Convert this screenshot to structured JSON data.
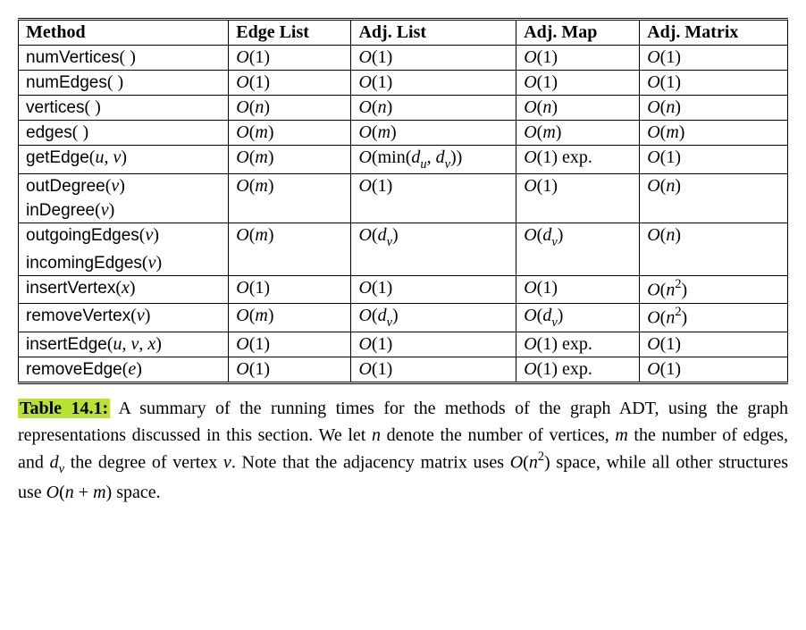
{
  "chart_data": {
    "type": "table",
    "title": "Table 14.1",
    "columns": [
      "Method",
      "Edge List",
      "Adj. List",
      "Adj. Map",
      "Adj. Matrix"
    ],
    "rows": [
      {
        "method": "numVertices()",
        "edge_list": "O(1)",
        "adj_list": "O(1)",
        "adj_map": "O(1)",
        "adj_matrix": "O(1)"
      },
      {
        "method": "numEdges()",
        "edge_list": "O(1)",
        "adj_list": "O(1)",
        "adj_map": "O(1)",
        "adj_matrix": "O(1)"
      },
      {
        "method": "vertices()",
        "edge_list": "O(n)",
        "adj_list": "O(n)",
        "adj_map": "O(n)",
        "adj_matrix": "O(n)"
      },
      {
        "method": "edges()",
        "edge_list": "O(m)",
        "adj_list": "O(m)",
        "adj_map": "O(m)",
        "adj_matrix": "O(m)"
      },
      {
        "method": "getEdge(u, v)",
        "edge_list": "O(m)",
        "adj_list": "O(min(d_u, d_v))",
        "adj_map": "O(1) exp.",
        "adj_matrix": "O(1)"
      },
      {
        "method": "outDegree(v) / inDegree(v)",
        "edge_list": "O(m)",
        "adj_list": "O(1)",
        "adj_map": "O(1)",
        "adj_matrix": "O(n)"
      },
      {
        "method": "outgoingEdges(v) / incomingEdges(v)",
        "edge_list": "O(m)",
        "adj_list": "O(d_v)",
        "adj_map": "O(d_v)",
        "adj_matrix": "O(n)"
      },
      {
        "method": "insertVertex(x)",
        "edge_list": "O(1)",
        "adj_list": "O(1)",
        "adj_map": "O(1)",
        "adj_matrix": "O(n^2)"
      },
      {
        "method": "removeVertex(v)",
        "edge_list": "O(m)",
        "adj_list": "O(d_v)",
        "adj_map": "O(d_v)",
        "adj_matrix": "O(n^2)"
      },
      {
        "method": "insertEdge(u, v, x)",
        "edge_list": "O(1)",
        "adj_list": "O(1)",
        "adj_map": "O(1) exp.",
        "adj_matrix": "O(1)"
      },
      {
        "method": "removeEdge(e)",
        "edge_list": "O(1)",
        "adj_list": "O(1)",
        "adj_map": "O(1) exp.",
        "adj_matrix": "O(1)"
      }
    ]
  },
  "headers": {
    "c0": "Method",
    "c1": "Edge List",
    "c2": "Adj. List",
    "c3": "Adj. Map",
    "c4": "Adj. Matrix"
  },
  "r0": {
    "m_name": "numVertices",
    "m_args": "( )"
  },
  "r1": {
    "m_name": "numEdges",
    "m_args": "( )"
  },
  "r2": {
    "m_name": "vertices",
    "m_args": "( )"
  },
  "r3": {
    "m_name": "edges",
    "m_args": "( )"
  },
  "r4": {
    "m_name": "getEdge",
    "m_open": "(",
    "a1": "u",
    "sep": ", ",
    "a2": "v",
    "m_close": ")",
    "exp": " exp."
  },
  "r5a": {
    "m_name": "outDegree",
    "m_open": "(",
    "a1": "v",
    "m_close": ")"
  },
  "r5b": {
    "m_name": "inDegree",
    "m_open": "(",
    "a1": "v",
    "m_close": ")"
  },
  "r6a": {
    "m_name": "outgoingEdges",
    "m_open": "(",
    "a1": "v",
    "m_close": ")"
  },
  "r6b": {
    "m_name": "incomingEdges",
    "m_open": "(",
    "a1": "v",
    "m_close": ")"
  },
  "r7": {
    "m_name": "insertVertex",
    "m_open": "(",
    "a1": "x",
    "m_close": ")"
  },
  "r8": {
    "m_name": "removeVertex",
    "m_open": "(",
    "a1": "v",
    "m_close": ")"
  },
  "r9": {
    "m_name": "insertEdge",
    "m_open": "(",
    "a1": "u",
    "s1": ", ",
    "a2": "v",
    "s2": ", ",
    "a3": "x",
    "m_close": ")",
    "exp": " exp."
  },
  "r10": {
    "m_name": "removeEdge",
    "m_open": "(",
    "a1": "e",
    "m_close": ")",
    "exp": " exp."
  },
  "O": {
    "o1": "O",
    "lp": "(",
    "rp": ")",
    "one": "1",
    "n": "n",
    "m": "m",
    "min_pre": "min(",
    "d": "d",
    "u": "u",
    "v": "v",
    "comma": ", ",
    "two": "2"
  },
  "caption": {
    "label": "Table 14.1:",
    "body_pre": " A summary of the running times for the methods of the graph ADT, using the graph representations discussed in this section. We let ",
    "n": "n",
    "body_mid1": " denote the number of vertices, ",
    "m": "m",
    "body_mid2": " the number of edges, and ",
    "d": "d",
    "v": "v",
    "body_mid3": " the degree of vertex ",
    "v2": "v",
    "body_mid4": ". Note that the adjacency matrix uses ",
    "o": "O",
    "lp": "(",
    "n2": "n",
    "sq": "2",
    "rp": ")",
    "body_mid5": " space, while all other structures use ",
    "o2": "O",
    "lp2": "(",
    "n3": "n",
    "plus": " + ",
    "m2": "m",
    "rp2": ")",
    "body_end": " space."
  }
}
